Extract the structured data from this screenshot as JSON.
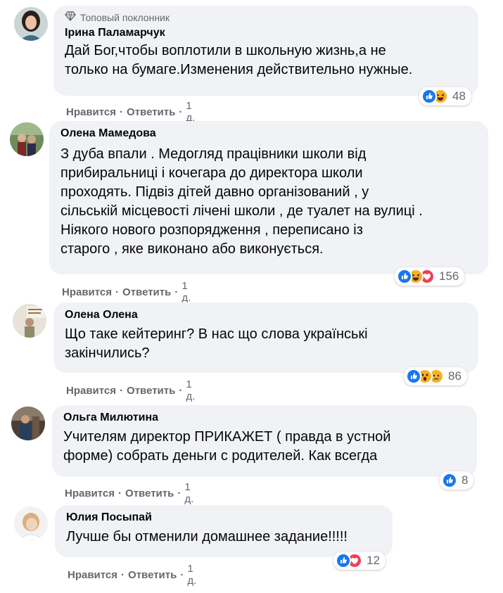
{
  "comments": [
    {
      "badge": "Топовый поклонник",
      "author": "Ірина Паламарчук",
      "lines": [
        "Дай Бог,чтобы воплотили в школьную жизнь,а не",
        "только на бумаге.Изменения действительно нужные."
      ],
      "like_label": "Нравится",
      "reply_label": "Ответить",
      "time": "1 д.",
      "reactions": [
        "like-icon",
        "haha-icon"
      ],
      "reaction_count": "48"
    },
    {
      "author": "Олена Мамедова",
      "lines": [
        "З дуба впали . Медогляд працівники школи від",
        "прибиральниці і кочегара до директора школи",
        "проходять. Підвіз дітей давно організований , у",
        "сільській місцевості лічені школи , де туалет на вулиці .",
        "Ніякого нового розпорядження , переписано із",
        "старого , яке виконано або виконується."
      ],
      "like_label": "Нравится",
      "reply_label": "Ответить",
      "time": "1 д.",
      "reactions": [
        "like-icon",
        "haha-icon",
        "love-icon"
      ],
      "reaction_count": "156"
    },
    {
      "author": "Олена Олена",
      "lines": [
        "Що таке кейтеринг? В нас що слова українські",
        "закінчились?"
      ],
      "like_label": "Нравится",
      "reply_label": "Ответить",
      "time": "1 д.",
      "reactions": [
        "like-icon",
        "wow-icon",
        "sad-icon"
      ],
      "reaction_count": "86"
    },
    {
      "author": "Ольга Милютина",
      "lines": [
        "Учителям директор ПРИКАЖЕТ ( правда в устной",
        "форме) собрать деньги с родителей. Как всегда"
      ],
      "like_label": "Нравится",
      "reply_label": "Ответить",
      "time": "1 д.",
      "reactions": [
        "like-icon"
      ],
      "reaction_count": "8"
    },
    {
      "author": "Юлия Посыпай",
      "lines": [
        "Лучше бы отменили домашнее задание!!!!!"
      ],
      "like_label": "Нравится",
      "reply_label": "Ответить",
      "time": "1 д.",
      "reactions": [
        "like-icon",
        "love-icon"
      ],
      "reaction_count": "12"
    }
  ],
  "colors": {
    "bubble": "#f0f2f5",
    "like": "#1877f2",
    "love": "#f33e58",
    "haha": "#f7b125",
    "secondary_text": "#65676b"
  }
}
